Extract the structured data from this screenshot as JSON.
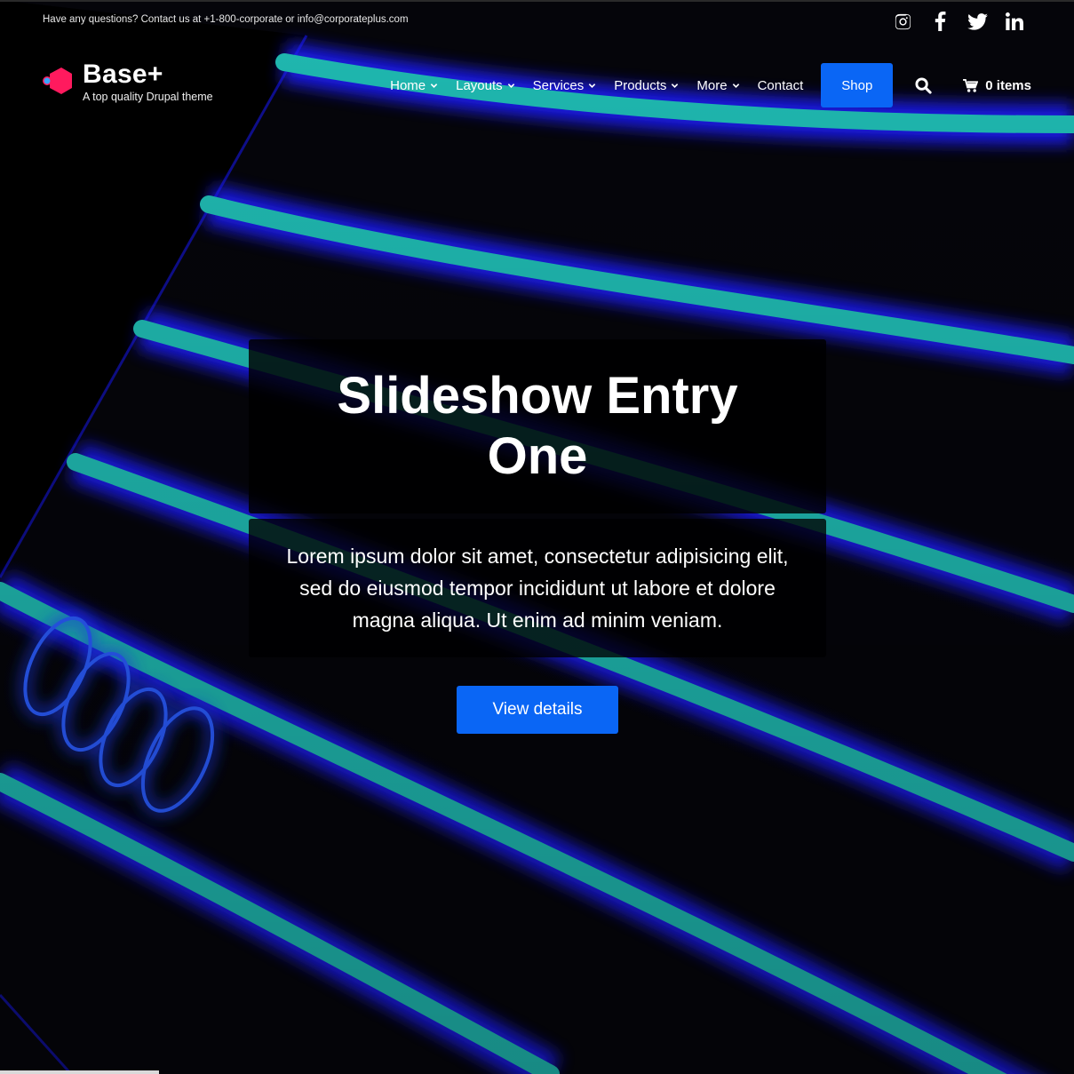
{
  "topbar": {
    "contact_text": "Have any questions? Contact us at +1-800-corporate or info@corporateplus.com",
    "social": [
      {
        "icon": "instagram-icon"
      },
      {
        "icon": "facebook-icon"
      },
      {
        "icon": "twitter-icon"
      },
      {
        "icon": "linkedin-icon"
      }
    ]
  },
  "brand": {
    "site_name": "Base+",
    "slogan": "A top quality Drupal theme"
  },
  "nav": {
    "items": [
      {
        "label": "Home",
        "has_dropdown": true
      },
      {
        "label": "Layouts",
        "has_dropdown": true
      },
      {
        "label": "Services",
        "has_dropdown": true
      },
      {
        "label": "Products",
        "has_dropdown": true
      },
      {
        "label": "More",
        "has_dropdown": true
      },
      {
        "label": "Contact",
        "has_dropdown": false
      }
    ],
    "shop_label": "Shop",
    "cart_label": "0 items"
  },
  "slide": {
    "title": "Slideshow Entry One",
    "text": "Lorem ipsum dolor sit amet, consectetur adipisicing elit, sed do eiusmod tempor incididunt ut labore et dolore magna aliqua. Ut enim ad minim veniam.",
    "button_label": "View details"
  },
  "colors": {
    "accent": "#0a66f5",
    "logo": "#ff1a5e",
    "neon": "#1fb8b0",
    "glow": "#1a1aff"
  }
}
